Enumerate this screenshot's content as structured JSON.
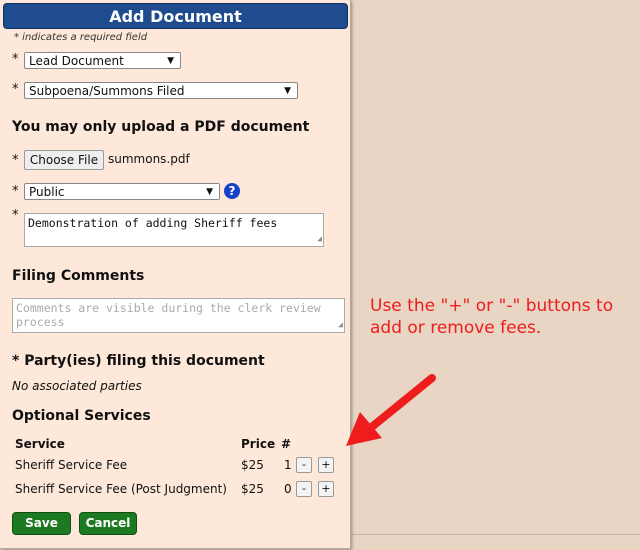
{
  "form": {
    "title": "Add Document",
    "required_note": "* indicates a required field",
    "required_star": "*",
    "lead_select": "Lead Document",
    "type_select": "Subpoena/Summons Filed",
    "pdf_heading": "You may only upload a PDF document",
    "choose_file_label": "Choose File",
    "file_name": "summons.pdf",
    "visibility_select": "Public",
    "help_glyph": "?",
    "description_value": "Demonstration of adding Sheriff fees",
    "filing_comments_heading": "Filing Comments",
    "comments_placeholder": "Comments are visible during the clerk review process",
    "parties_heading": "* Party(ies) filing this document",
    "no_parties_text": "No associated parties",
    "optional_services_heading": "Optional Services",
    "services_table": {
      "headers": {
        "service": "Service",
        "price": "Price",
        "count": "#"
      },
      "rows": [
        {
          "service": "Sheriff Service Fee",
          "price": "$25",
          "count": "1",
          "minus": "-",
          "plus": "+"
        },
        {
          "service": "Sheriff Service Fee (Post Judgment)",
          "price": "$25",
          "count": "0",
          "minus": "-",
          "plus": "+"
        }
      ]
    },
    "save_label": "Save",
    "cancel_label": "Cancel"
  },
  "annotation": {
    "text": "Use the \"+\" or \"-\" buttons to add or remove fees."
  },
  "icons": {
    "dropdown": "chevron-down-icon",
    "help": "help-icon",
    "arrow": "red-arrow-icon"
  },
  "colors": {
    "title_bar": "#1f4c8f",
    "panel_bg": "#fde8da",
    "page_bg": "#e8d5c4",
    "button_green": "#1e7a22",
    "annotation_red": "#ee1c1c",
    "help_blue": "#1640c8"
  }
}
